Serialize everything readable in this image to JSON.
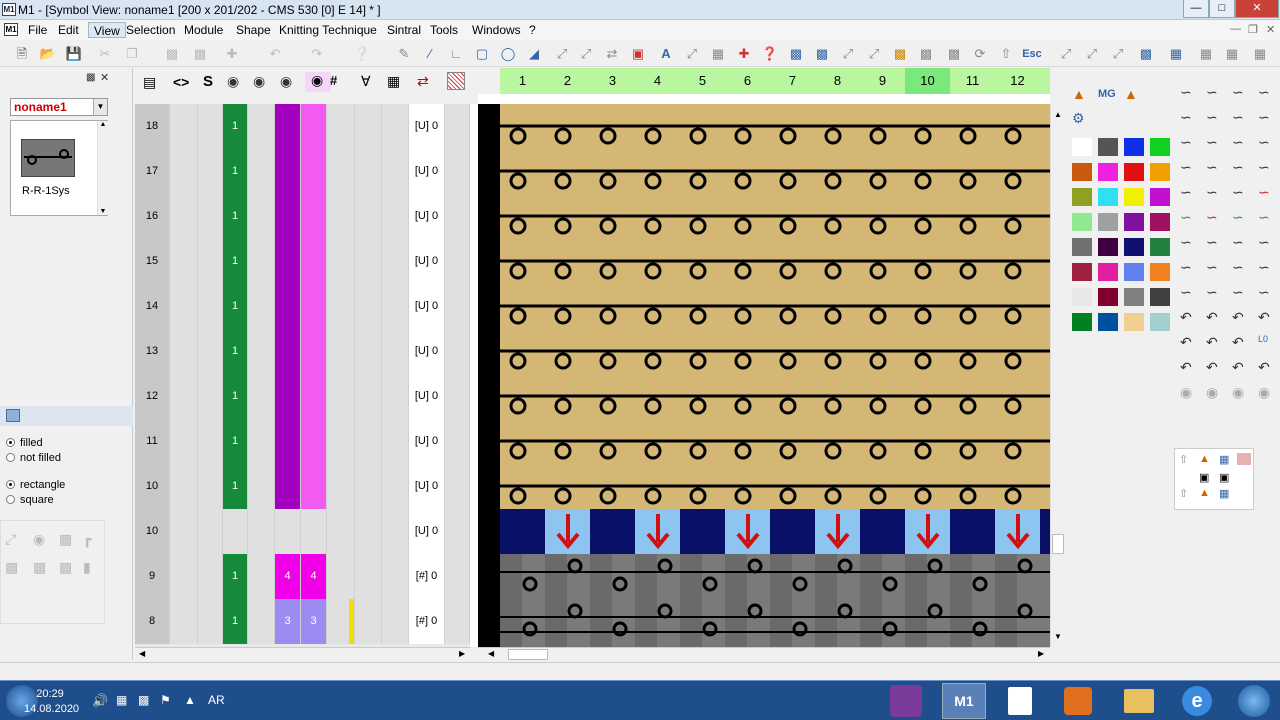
{
  "window": {
    "title": "M1 - [Symbol View: noname1 [200 x 201/202 - CMS 530 [0]  E 14] * ]",
    "app_icon": "M1"
  },
  "menu": [
    "File",
    "Edit",
    "View",
    "Selection",
    "Module",
    "Shape",
    "Knitting Technique",
    "Sintral",
    "Tools",
    "Windows",
    "?"
  ],
  "left": {
    "combo_value": "noname1",
    "symbol_name": "R-R-1Sys",
    "fill_filled": "filled",
    "fill_not_filled": "not filled",
    "shape_rect": "rectangle",
    "shape_square": "square"
  },
  "rows": [
    {
      "num": "18",
      "c1": "1",
      "mid": "",
      "sys": "[U] 0",
      "type": "purple"
    },
    {
      "num": "17",
      "c1": "1",
      "mid": "",
      "sys": "[U] 0",
      "type": "purple"
    },
    {
      "num": "16",
      "c1": "1",
      "mid": "",
      "sys": "[U] 0",
      "type": "purple"
    },
    {
      "num": "15",
      "c1": "1",
      "mid": "",
      "sys": "[U] 0",
      "type": "purple"
    },
    {
      "num": "14",
      "c1": "1",
      "mid": "",
      "sys": "[U] 0",
      "type": "purple"
    },
    {
      "num": "13",
      "c1": "1",
      "mid": "",
      "sys": "[U] 0",
      "type": "purple"
    },
    {
      "num": "12",
      "c1": "1",
      "mid": "",
      "sys": "[U] 0",
      "type": "purple"
    },
    {
      "num": "11",
      "c1": "1",
      "mid": "",
      "sys": "[U] 0",
      "type": "purple"
    },
    {
      "num": "10",
      "c1": "1",
      "mid": "",
      "sys": "[U] 0",
      "type": "purple"
    },
    {
      "num": "10",
      "c1": "",
      "mid": "",
      "sys": "[U] 0",
      "type": "empty"
    },
    {
      "num": "9",
      "c1": "1",
      "mid": "4",
      "sys": "[#] 0",
      "type": "magenta"
    },
    {
      "num": "8",
      "c1": "1",
      "mid": "3",
      "sys": "[#] 0",
      "type": "lilac"
    }
  ],
  "columns": [
    "1",
    "2",
    "3",
    "4",
    "5",
    "6",
    "7",
    "8",
    "9",
    "10",
    "11",
    "12"
  ],
  "clock": {
    "time": "20:29",
    "date": "14.08.2020",
    "lang": "AR"
  },
  "taskbar_app": "M1",
  "colors": {
    "green": "#168a3a",
    "purple": "#a400c0",
    "pink": "#f25af0",
    "magenta": "#f000e8",
    "lilac": "#9c8cf2",
    "tan": "#d4b675",
    "navy": "#081068",
    "lightblue": "#8ec4f0"
  }
}
